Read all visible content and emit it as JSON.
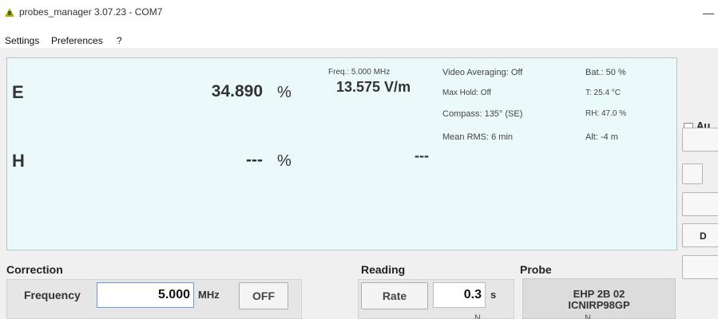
{
  "window": {
    "title": "probes_manager 3.07.23 - COM7",
    "minimize_glyph": "—"
  },
  "menu": {
    "items": [
      "Settings",
      "Preferences",
      "?"
    ]
  },
  "measure": {
    "e_label": "E",
    "e_percent": "34.890",
    "percent_unit": "%",
    "freq_label": "Freq.: 5.000 MHz",
    "e_field": "13.575 V/m",
    "h_label": "H",
    "h_percent": "---",
    "h_field": "---",
    "status": {
      "video_avg": "Video Averaging: Off",
      "max_hold": "Max Hold: Off",
      "compass": "Compass: 135° (SE)",
      "mean_rms": "Mean RMS: 6 min",
      "bat": "Bat.:  50 %",
      "temp": "T: 25.4 °C",
      "rh": "RH: 47.0 %",
      "alt": "Alt: -4 m"
    }
  },
  "sidebar": {
    "auto_label": "Au",
    "btn_d_label": "D"
  },
  "correction": {
    "title": "Correction",
    "frequency_label": "Frequency",
    "frequency_value": "5.000",
    "frequency_unit": "MHz",
    "off_button": "OFF"
  },
  "reading": {
    "title": "Reading",
    "rate_label": "Rate",
    "rate_value": "0.3",
    "rate_unit": "s"
  },
  "probe": {
    "title": "Probe",
    "line1": "EHP 2B 02",
    "line2": "ICNIRP98GP"
  },
  "cut_texts": {
    "a": "N",
    "b": "N"
  }
}
